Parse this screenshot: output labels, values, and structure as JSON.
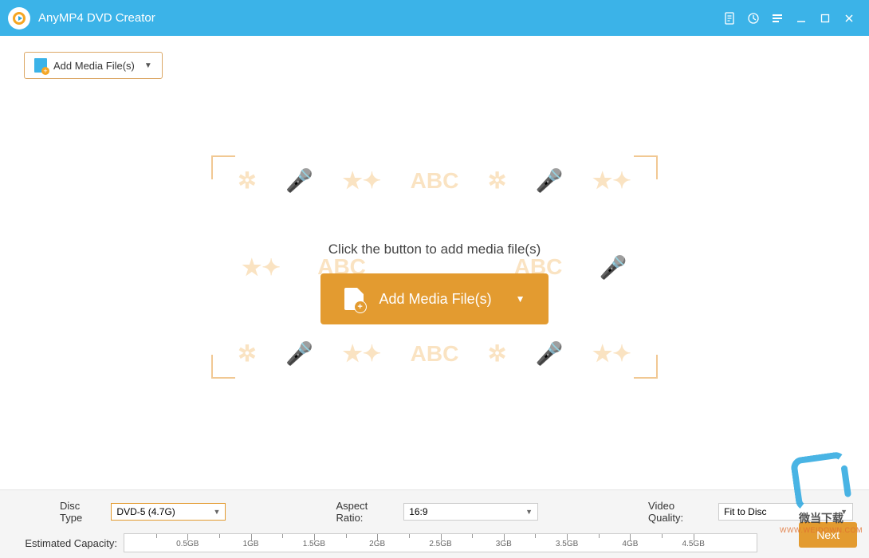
{
  "app_title": "AnyMP4 DVD Creator",
  "toolbar": {
    "add_media_label": "Add Media File(s)"
  },
  "main": {
    "hint": "Click the button to add media file(s)",
    "add_media_label": "Add Media File(s)",
    "bg_text": "ABC"
  },
  "bottom": {
    "disc_type_label": "Disc Type",
    "disc_type_value": "DVD-5 (4.7G)",
    "aspect_ratio_label": "Aspect Ratio:",
    "aspect_ratio_value": "16:9",
    "video_quality_label": "Video Quality:",
    "video_quality_value": "Fit to Disc",
    "capacity_label": "Estimated Capacity:",
    "ticks": [
      "0.5GB",
      "1GB",
      "1.5GB",
      "2GB",
      "2.5GB",
      "3GB",
      "3.5GB",
      "4GB",
      "4.5GB"
    ],
    "next_label": "Next"
  },
  "watermark": {
    "text": "微当下载",
    "url": "WWW.WEIDOWN.COM"
  }
}
